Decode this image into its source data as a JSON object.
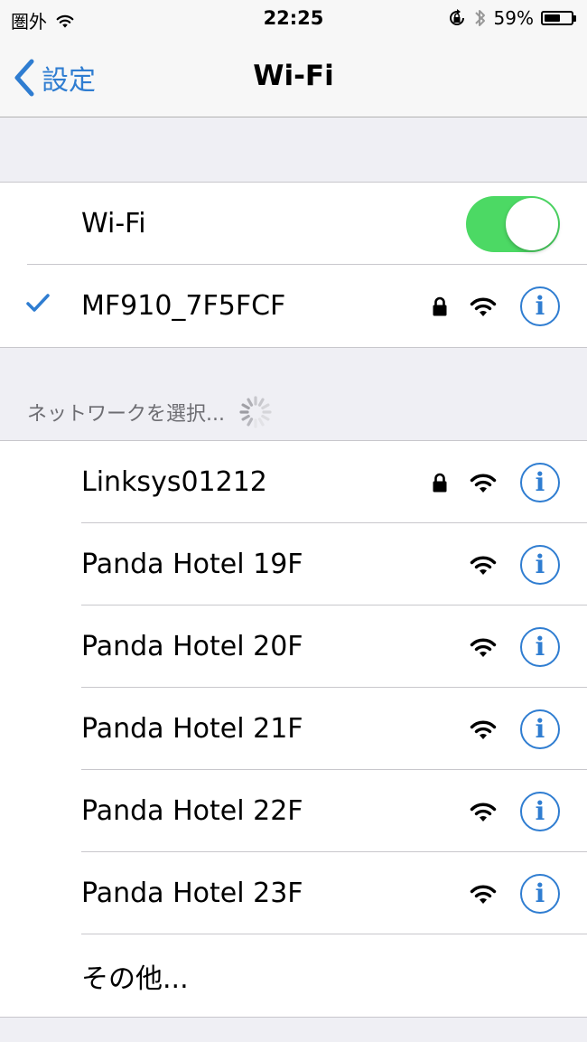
{
  "status_bar": {
    "carrier": "圏外",
    "time": "22:25",
    "battery": "59%",
    "battery_level": 0.59,
    "icons": [
      "wifi-icon",
      "rotation-lock-icon",
      "bluetooth-icon",
      "battery-icon"
    ]
  },
  "nav": {
    "back_label": "設定",
    "title": "Wi-Fi"
  },
  "wifi_toggle": {
    "label": "Wi-Fi",
    "on": true
  },
  "connected_network": {
    "name": "MF910_7F5FCF",
    "locked": true
  },
  "section_header": "ネットワークを選択...",
  "networks": [
    {
      "name": "Linksys01212",
      "locked": true
    },
    {
      "name": "Panda Hotel 19F",
      "locked": false
    },
    {
      "name": "Panda Hotel 20F",
      "locked": false
    },
    {
      "name": "Panda Hotel 21F",
      "locked": false
    },
    {
      "name": "Panda Hotel 22F",
      "locked": false
    },
    {
      "name": "Panda Hotel 23F",
      "locked": false
    }
  ],
  "other_label": "その他...",
  "info_glyph": "i",
  "colors": {
    "accent": "#2f7dd1",
    "toggle_on": "#4cd964",
    "background": "#efeff4"
  }
}
